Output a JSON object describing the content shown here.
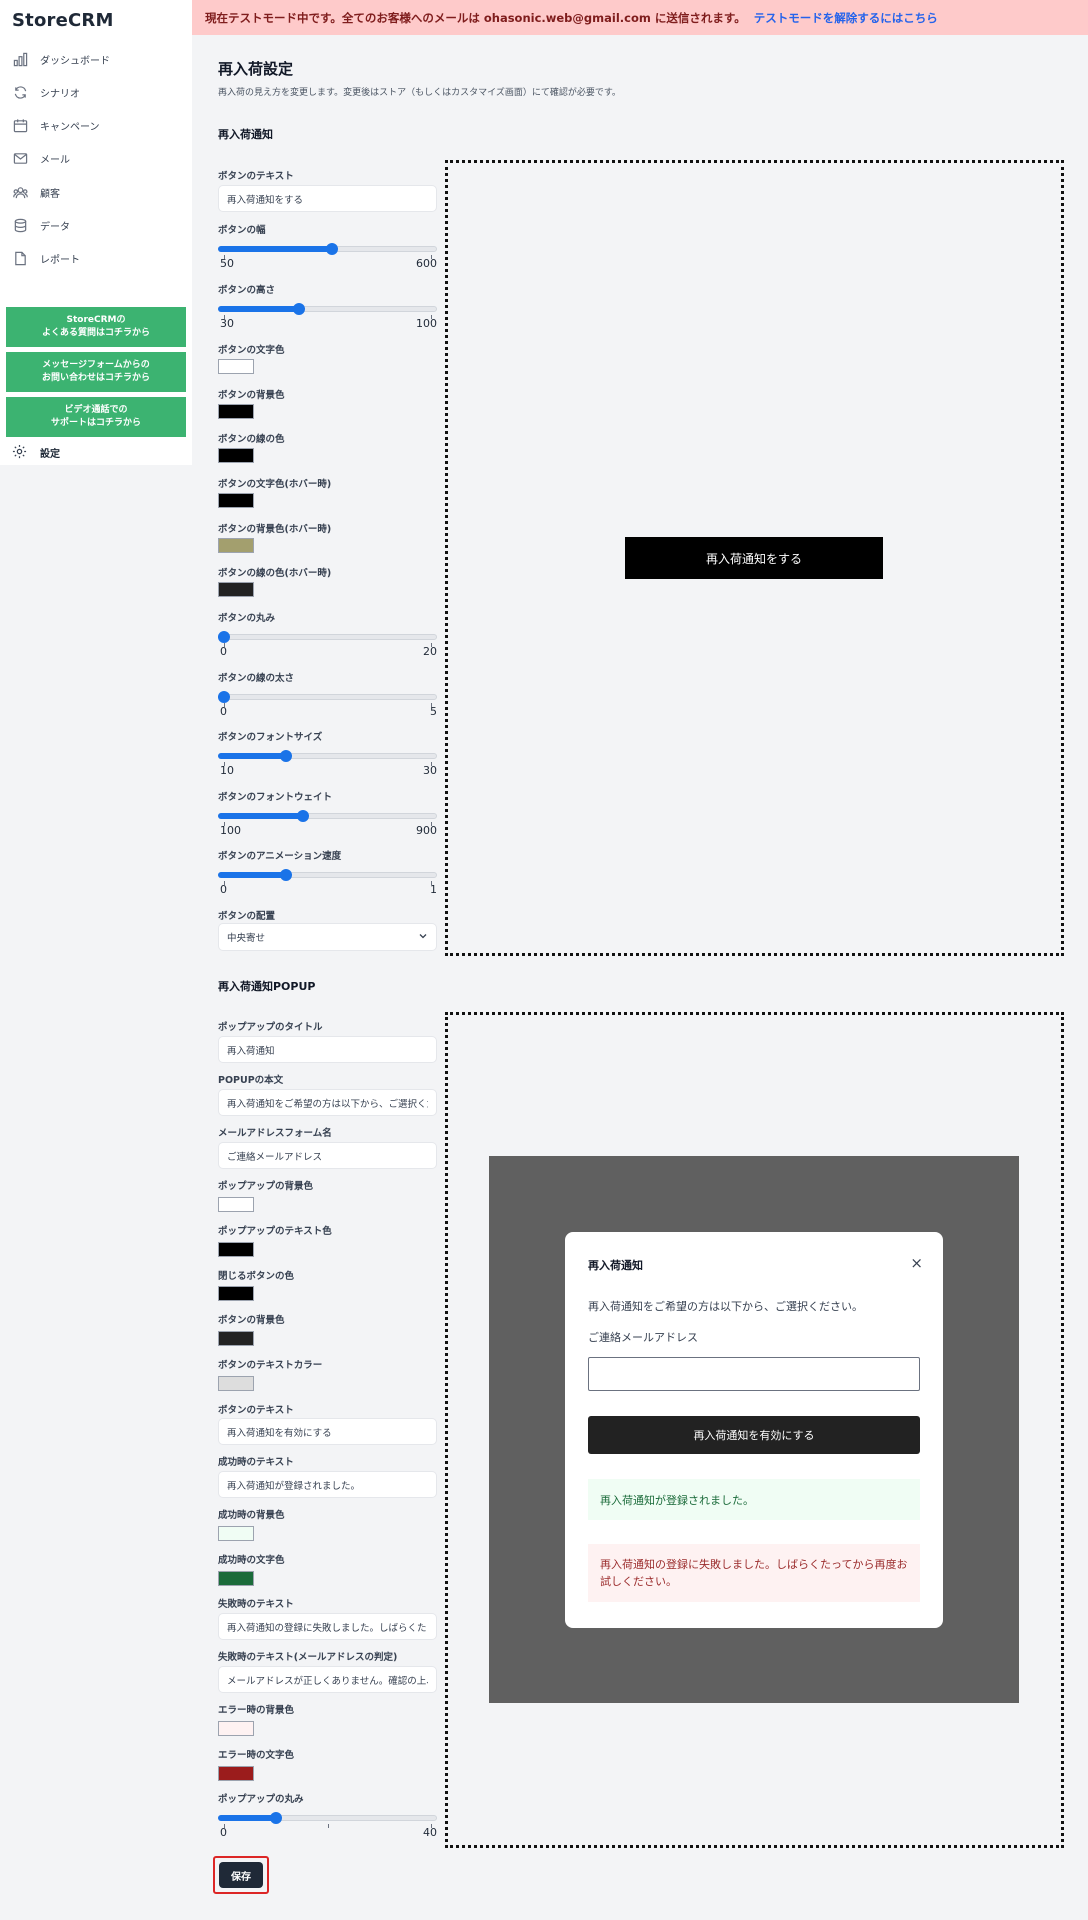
{
  "app": {
    "logo": "StoreCRM"
  },
  "sidebar": {
    "items": [
      {
        "label": "ダッシュボード",
        "icon": "bar-chart-icon"
      },
      {
        "label": "シナリオ",
        "icon": "refresh-icon"
      },
      {
        "label": "キャンペーン",
        "icon": "calendar-icon"
      },
      {
        "label": "メール",
        "icon": "mail-icon"
      },
      {
        "label": "顧客",
        "icon": "users-icon"
      },
      {
        "label": "データ",
        "icon": "database-icon"
      },
      {
        "label": "レポート",
        "icon": "document-icon"
      }
    ],
    "help_buttons": [
      "StoreCRMの\nよくある質問はコチラから",
      "メッセージフォームからの\nお問い合わせはコチラから",
      "ビデオ通話での\nサポートはコチラから"
    ],
    "settings_label": "設定"
  },
  "banner": {
    "text": "現在テストモード中です。全てのお客様へのメールは ohasonic.web@gmail.com に送信されます。",
    "link": "テストモードを解除するにはこちら"
  },
  "page": {
    "title": "再入荷設定",
    "description": "再入荷の見え方を変更します。変更後はストア（もしくはカスタマイズ画面）にて確認が必要です。"
  },
  "notify_section": {
    "title": "再入荷通知",
    "button_text_label": "ボタンのテキスト",
    "button_text_value": "再入荷通知をする",
    "width": {
      "label": "ボタンの幅",
      "min": "50",
      "max": "600",
      "fraction": 0.52
    },
    "height": {
      "label": "ボタンの高さ",
      "min": "30",
      "max": "100",
      "fraction": 0.36
    },
    "colors": [
      {
        "label": "ボタンの文字色",
        "color": "#ffffff"
      },
      {
        "label": "ボタンの背景色",
        "color": "#000000"
      },
      {
        "label": "ボタンの線の色",
        "color": "#000000"
      },
      {
        "label": "ボタンの文字色(ホバー時)",
        "color": "#000000"
      },
      {
        "label": "ボタンの背景色(ホバー時)",
        "color": "#a39f6e"
      },
      {
        "label": "ボタンの線の色(ホバー時)",
        "color": "#222222"
      }
    ],
    "radius": {
      "label": "ボタンの丸み",
      "min": "0",
      "max": "20",
      "fraction": 0.0
    },
    "border_width": {
      "label": "ボタンの線の太さ",
      "min": "0",
      "max": "5",
      "fraction": 0.0
    },
    "font_size": {
      "label": "ボタンのフォントサイズ",
      "min": "10",
      "max": "30",
      "fraction": 0.3
    },
    "font_weight": {
      "label": "ボタンのフォントウェイト",
      "min": "100",
      "max": "900",
      "fraction": 0.38
    },
    "anim_speed": {
      "label": "ボタンのアニメーション速度",
      "min": "0",
      "max": "1",
      "fraction": 0.3
    },
    "align_label": "ボタンの配置",
    "align_value": "中央寄せ",
    "preview_button": "再入荷通知をする"
  },
  "popup_section": {
    "title": "再入荷通知POPUP",
    "fields": {
      "title_label": "ポップアップのタイトル",
      "title_value": "再入荷通知",
      "body_label": "POPUPの本文",
      "body_value": "再入荷通知をご希望の方は以下から、ご選択ください。",
      "email_label": "メールアドレスフォーム名",
      "email_value": "ご連絡メールアドレス",
      "popup_bg_label": "ポップアップの背景色",
      "popup_text_label": "ポップアップのテキスト色",
      "close_color_label": "閉じるボタンの色",
      "btn_bg_label": "ボタンの背景色",
      "btn_text_color_label": "ボタンのテキストカラー",
      "btn_text_label": "ボタンのテキスト",
      "btn_text_value": "再入荷通知を有効にする",
      "success_text_label": "成功時のテキスト",
      "success_text_value": "再入荷通知が登録されました。",
      "success_bg_label": "成功時の背景色",
      "success_color_label": "成功時の文字色",
      "fail_text_label": "失敗時のテキスト",
      "fail_text_value": "再入荷通知の登録に失敗しました。しばらくたってから再度お試しください。",
      "fail_email_label": "失敗時のテキスト(メールアドレスの判定)",
      "fail_email_value": "メールアドレスが正しくありません。確認の上、再度お試しください。",
      "error_bg_label": "エラー時の背景色",
      "error_color_label": "エラー時の文字色"
    },
    "colors": {
      "popup_bg": "#ffffff",
      "popup_text": "#000000",
      "close": "#000000",
      "btn_bg": "#222222",
      "btn_text": "#dddddd",
      "success_bg": "#f0fdf4",
      "success_color": "#1b6b3a",
      "error_bg": "#fef2f2",
      "error_color": "#9b1c1c"
    },
    "radius": {
      "label": "ポップアップの丸み",
      "min": "0",
      "max": "40",
      "fraction": 0.25
    },
    "preview": {
      "title": "再入荷通知",
      "close": "×",
      "body": "再入荷通知をご希望の方は以下から、ご選択ください。",
      "email_label": "ご連絡メールアドレス",
      "button": "再入荷通知を有効にする",
      "success": "再入荷通知が登録されました。",
      "error": "再入荷通知の登録に失敗しました。しばらくたってから再度お試しください。"
    }
  },
  "save_label": "保存"
}
